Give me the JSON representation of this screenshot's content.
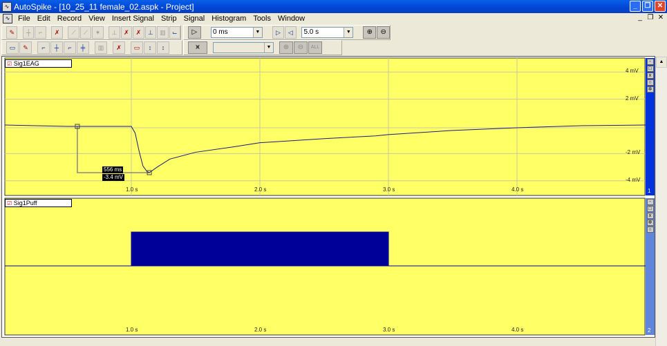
{
  "window": {
    "title": "AutoSpike - [10_25_11 female_02.aspk - Project]"
  },
  "menu": [
    "File",
    "Edit",
    "Record",
    "View",
    "Insert Signal",
    "Strip",
    "Signal",
    "Histogram",
    "Tools",
    "Window"
  ],
  "toolbar": {
    "offset_value": "0 ms",
    "duration_value": "5.0 s",
    "display_value": ""
  },
  "strips": [
    {
      "name": "Sig1EAG",
      "number": "1",
      "accent": "#0033dd",
      "y_ticks": [
        {
          "v": 4,
          "label": "4 mV"
        },
        {
          "v": 2,
          "label": "2 mV"
        },
        {
          "v": -2,
          "label": "-2 mV"
        },
        {
          "v": -4,
          "label": "-4 mV"
        }
      ],
      "x_ticks": [
        {
          "v": 1,
          "label": "1.0 s"
        },
        {
          "v": 2,
          "label": "2.0 s"
        },
        {
          "v": 3,
          "label": "3.0 s"
        },
        {
          "v": 4,
          "label": "4.0 s"
        }
      ],
      "measurement": {
        "dt_label": "556 ms",
        "dv_label": "-3.4 mV",
        "start": [
          0.58,
          0.0
        ],
        "end": [
          1.14,
          -3.4
        ]
      }
    },
    {
      "name": "Sig1Puff",
      "number": "2",
      "accent": "#5f86dc",
      "x_ticks": [
        {
          "v": 1,
          "label": "1.0 s"
        },
        {
          "v": 2,
          "label": "2.0 s"
        },
        {
          "v": 3,
          "label": "3.0 s"
        },
        {
          "v": 4,
          "label": "4.0 s"
        }
      ]
    }
  ],
  "chart_data": [
    {
      "type": "line",
      "title": "Sig1EAG",
      "xlabel": "s",
      "ylabel": "mV",
      "xlim": [
        0,
        5
      ],
      "ylim": [
        -5,
        5
      ],
      "x": [
        0.0,
        0.5,
        0.9,
        1.0,
        1.03,
        1.06,
        1.09,
        1.12,
        1.14,
        1.2,
        1.3,
        1.5,
        1.8,
        2.0,
        2.5,
        2.9,
        3.0,
        3.5,
        4.0,
        4.5,
        5.0
      ],
      "y": [
        0.1,
        0.0,
        0.0,
        0.0,
        -0.5,
        -1.8,
        -2.9,
        -3.3,
        -3.4,
        -3.0,
        -2.4,
        -1.9,
        -1.5,
        -1.2,
        -0.9,
        -0.7,
        -0.6,
        -0.3,
        -0.1,
        0.05,
        0.1
      ]
    },
    {
      "type": "area",
      "title": "Sig1Puff",
      "xlim": [
        0,
        5
      ],
      "ylim": [
        -1,
        1
      ],
      "x": [
        0,
        1.0,
        1.0,
        3.0,
        3.0,
        5.0
      ],
      "y": [
        0,
        0,
        1,
        1,
        0,
        0
      ]
    }
  ]
}
